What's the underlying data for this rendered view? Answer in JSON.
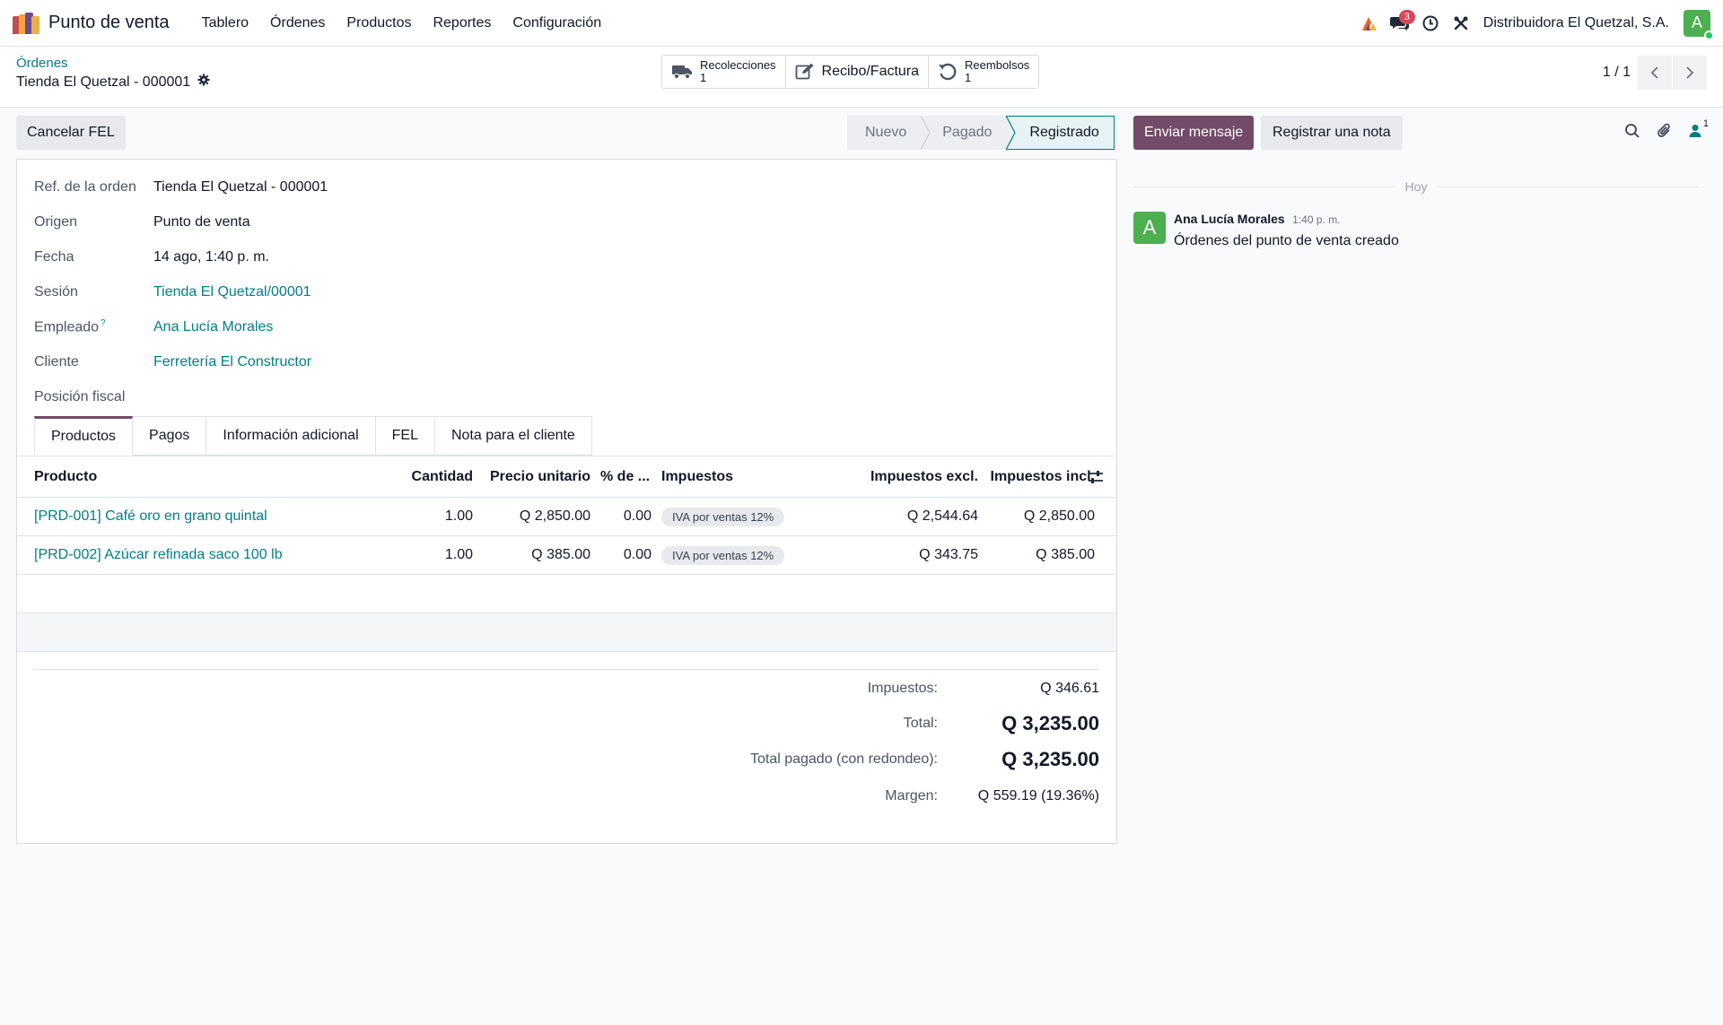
{
  "navbar": {
    "app_title": "Punto de venta",
    "menu": [
      "Tablero",
      "Órdenes",
      "Productos",
      "Reportes",
      "Configuración"
    ],
    "messages_badge": "3",
    "company": "Distribuidora El Quetzal, S.A.",
    "user_initial": "A",
    "icons": [
      "brand-icon",
      "chat-icon",
      "clock-icon",
      "tools-icon"
    ]
  },
  "control_panel": {
    "breadcrumb": "Órdenes",
    "record_title": "Tienda El Quetzal - 000001",
    "smart_buttons": {
      "pickings_label": "Recolecciones",
      "pickings_count": "1",
      "invoice_label": "Recibo/Factura",
      "refunds_label": "Reembolsos",
      "refunds_count": "1"
    },
    "pager": "1 / 1"
  },
  "status_bar": {
    "cancel_button": "Cancelar FEL",
    "steps": [
      "Nuevo",
      "Pagado",
      "Registrado"
    ],
    "active_step": "Registrado"
  },
  "form": {
    "fields": [
      {
        "label": "Ref. de la orden",
        "value": "Tienda El Quetzal - 000001",
        "link": false
      },
      {
        "label": "Origen",
        "value": "Punto de venta",
        "link": false
      },
      {
        "label": "Fecha",
        "value": "14 ago, 1:40 p. m.",
        "link": false
      },
      {
        "label": "Sesión",
        "value": "Tienda El Quetzal/00001",
        "link": true
      },
      {
        "label": "Empleado",
        "value": "Ana Lucía Morales",
        "link": true,
        "help": "?"
      },
      {
        "label": "Cliente",
        "value": "Ferretería El Constructor",
        "link": true
      },
      {
        "label": "Posición fiscal",
        "value": "",
        "link": false
      }
    ],
    "tabs": [
      "Productos",
      "Pagos",
      "Información adicional",
      "FEL",
      "Nota para el cliente"
    ],
    "active_tab": "Productos",
    "table": {
      "headers": {
        "product": "Producto",
        "qty": "Cantidad",
        "price": "Precio unitario",
        "discount": "% de ...",
        "taxes": "Impuestos",
        "subtotal": "Impuestos excl.",
        "total": "Impuestos incl."
      },
      "rows": [
        {
          "product": "[PRD-001] Café oro en grano quintal",
          "qty": "1.00",
          "price": "Q 2,850.00",
          "discount": "0.00",
          "tax": "IVA por ventas 12%",
          "subtotal": "Q 2,544.64",
          "total": "Q 2,850.00"
        },
        {
          "product": "[PRD-002] Azúcar refinada saco 100 lb",
          "qty": "1.00",
          "price": "Q 385.00",
          "discount": "0.00",
          "tax": "IVA por ventas 12%",
          "subtotal": "Q 343.75",
          "total": "Q 385.00"
        }
      ]
    },
    "totals": {
      "taxes_label": "Impuestos:",
      "taxes_value": "Q 346.61",
      "total_label": "Total:",
      "total_value": "Q 3,235.00",
      "paid_label": "Total pagado (con redondeo):",
      "paid_value": "Q 3,235.00",
      "margin_label": "Margen:",
      "margin_value": "Q 559.19 (19.36%)"
    }
  },
  "chatter": {
    "send_message": "Enviar mensaje",
    "log_note": "Registrar una nota",
    "followers_count": "1",
    "day": "Hoy",
    "message": {
      "author": "Ana Lucía Morales",
      "time": "1:40 p. m.",
      "body": "Órdenes del punto de venta creado",
      "avatar_initial": "A"
    }
  },
  "colors": {
    "brand": "#714b67",
    "link": "#017e84",
    "avatar": "#4caf50",
    "badge": "#d9475a"
  }
}
